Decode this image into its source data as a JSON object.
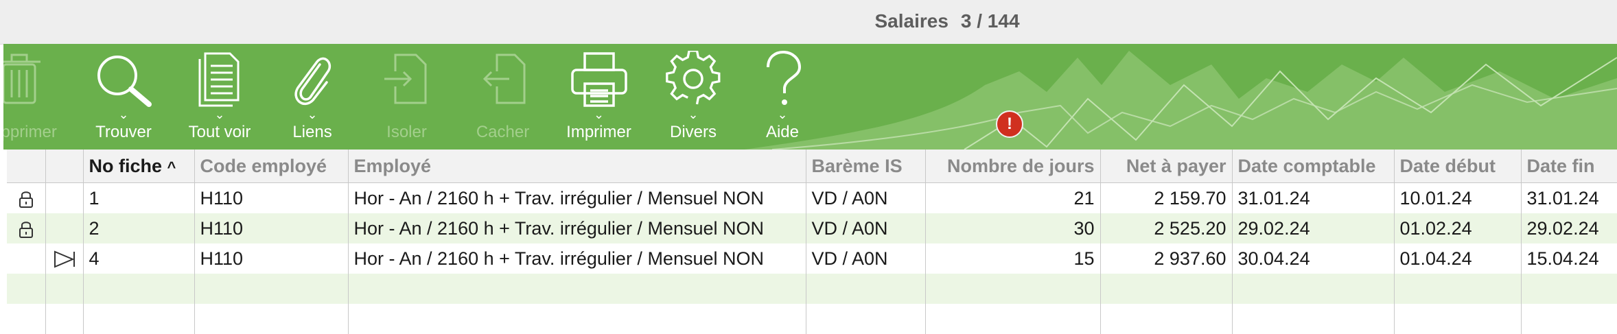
{
  "window": {
    "title": "Salaires",
    "record_count": "3 / 144"
  },
  "toolbar": {
    "items": [
      {
        "label": "Supprimer",
        "icon": "trash-icon",
        "enabled": false
      },
      {
        "label": "Trouver",
        "icon": "search-icon",
        "enabled": true
      },
      {
        "label": "Tout voir",
        "icon": "document-list-icon",
        "enabled": true
      },
      {
        "label": "Liens",
        "icon": "paperclip-icon",
        "enabled": true
      },
      {
        "label": "Isoler",
        "icon": "isolate-icon",
        "enabled": false
      },
      {
        "label": "Cacher",
        "icon": "hide-icon",
        "enabled": false
      },
      {
        "label": "Imprimer",
        "icon": "printer-icon",
        "enabled": true
      },
      {
        "label": "Divers",
        "icon": "gear-icon",
        "enabled": true
      },
      {
        "label": "Aide",
        "icon": "question-icon",
        "enabled": true
      }
    ],
    "background_color": "#6ab04c"
  },
  "alert_badge": "!",
  "table": {
    "columns": [
      "No fiche",
      "Code employé",
      "Employé",
      "Barème IS",
      "Nombre de jours",
      "Net à payer",
      "Date comptable",
      "Date début",
      "Date fin"
    ],
    "sort_indicator": "^",
    "rows": [
      {
        "locked": true,
        "current": false,
        "cells": [
          "1",
          "H110",
          "Hor - An / 2160 h + Trav. irrégulier / Mensuel NON",
          "VD / A0N",
          "21",
          "2 159.70",
          "31.01.24",
          "10.01.24",
          "31.01.24"
        ]
      },
      {
        "locked": true,
        "current": false,
        "cells": [
          "2",
          "H110",
          "Hor - An / 2160 h + Trav. irrégulier / Mensuel NON",
          "VD / A0N",
          "30",
          "2 525.20",
          "29.02.24",
          "01.02.24",
          "29.02.24"
        ]
      },
      {
        "locked": false,
        "current": true,
        "cells": [
          "4",
          "H110",
          "Hor - An / 2160 h + Trav. irrégulier / Mensuel NON",
          "VD / A0N",
          "15",
          "2 937.60",
          "30.04.24",
          "01.04.24",
          "15.04.24"
        ]
      }
    ]
  }
}
